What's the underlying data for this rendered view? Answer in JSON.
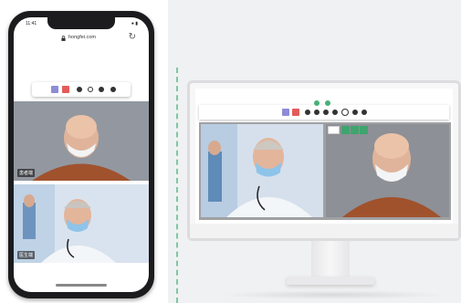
{
  "phone": {
    "status_time": "11:41",
    "status_right": "● ▮",
    "url": "hongfei.com",
    "video_labels": [
      "患者端",
      "医生端"
    ]
  },
  "icons": {
    "lock": "lock-icon",
    "reload": "reload-icon",
    "video_toggle": "purple-square-icon",
    "hangup": "red-square-icon",
    "mic": "mic-icon"
  },
  "colors": {
    "accent_purple": "#8e8bd8",
    "accent_red": "#e35b5b",
    "accent_green": "#48b07a",
    "divider": "#7fc7a4"
  }
}
